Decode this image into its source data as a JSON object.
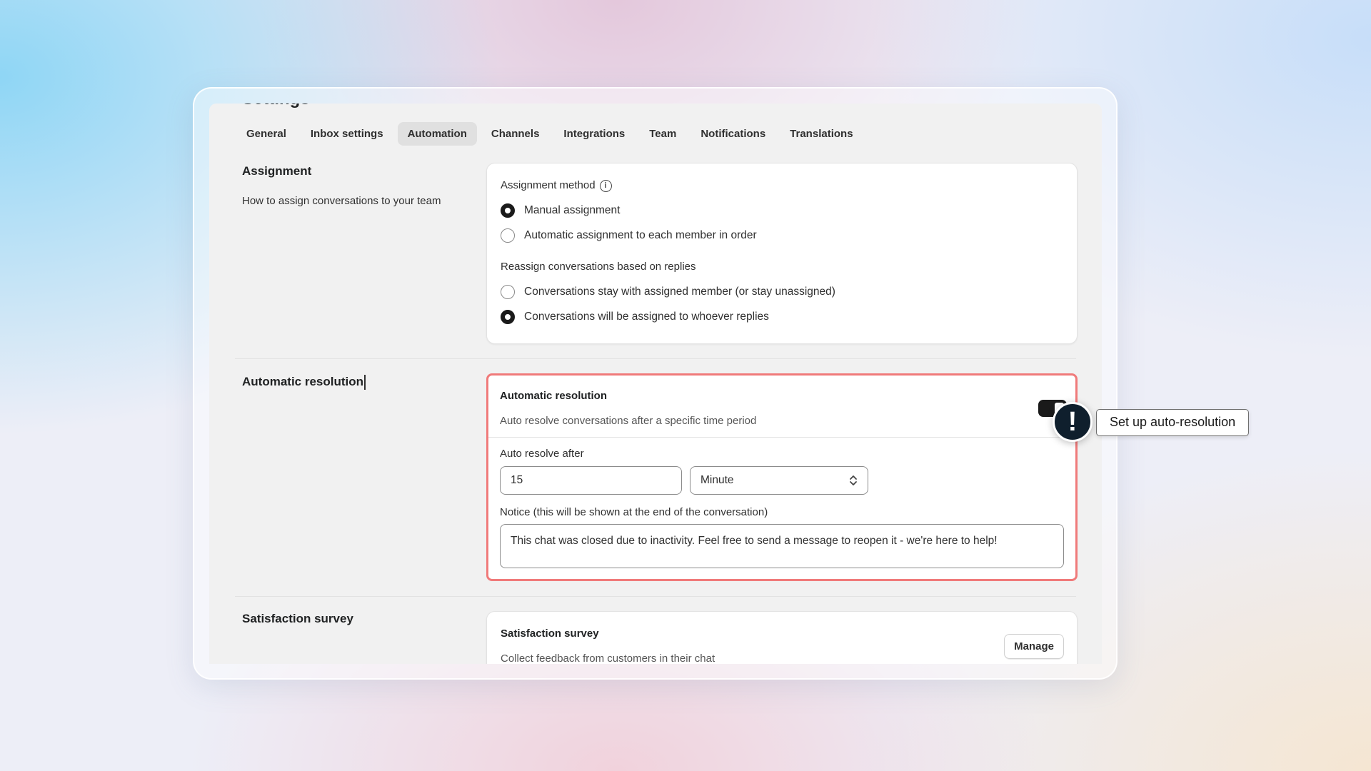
{
  "page": {
    "title_clipped": "Settings"
  },
  "tabs": [
    {
      "label": "General"
    },
    {
      "label": "Inbox settings"
    },
    {
      "label": "Automation",
      "active": true
    },
    {
      "label": "Channels"
    },
    {
      "label": "Integrations"
    },
    {
      "label": "Team"
    },
    {
      "label": "Notifications"
    },
    {
      "label": "Translations"
    }
  ],
  "assignment": {
    "title": "Assignment",
    "description": "How to assign conversations to your team",
    "method_label": "Assignment method",
    "options": [
      {
        "label": "Manual assignment",
        "selected": true
      },
      {
        "label": "Automatic assignment to each member in order",
        "selected": false
      }
    ],
    "reassign_label": "Reassign conversations based on replies",
    "reassign_options": [
      {
        "label": "Conversations stay with assigned member (or stay unassigned)",
        "selected": false
      },
      {
        "label": "Conversations will be assigned to whoever replies",
        "selected": true
      }
    ]
  },
  "auto_resolution": {
    "section_title": "Automatic resolution",
    "card_title": "Automatic resolution",
    "card_desc": "Auto resolve conversations after a specific time period",
    "toggle_on": true,
    "after_label": "Auto resolve after",
    "after_value": "15",
    "unit_value": "Minute",
    "notice_label": "Notice (this will be shown at the end of the conversation)",
    "notice_value": "This chat was closed due to inactivity. Feel free to send a message to reopen it - we're here to help!"
  },
  "survey": {
    "section_title": "Satisfaction survey",
    "card_title": "Satisfaction survey",
    "card_desc": "Collect feedback from customers in their chat",
    "manage_label": "Manage"
  },
  "annotation": {
    "badge": "!",
    "tooltip": "Set up auto-resolution"
  },
  "colors": {
    "highlight_border": "#f07a7a",
    "badge_bg": "#0f1f2d",
    "active_tab_bg": "#e0e0e0"
  }
}
